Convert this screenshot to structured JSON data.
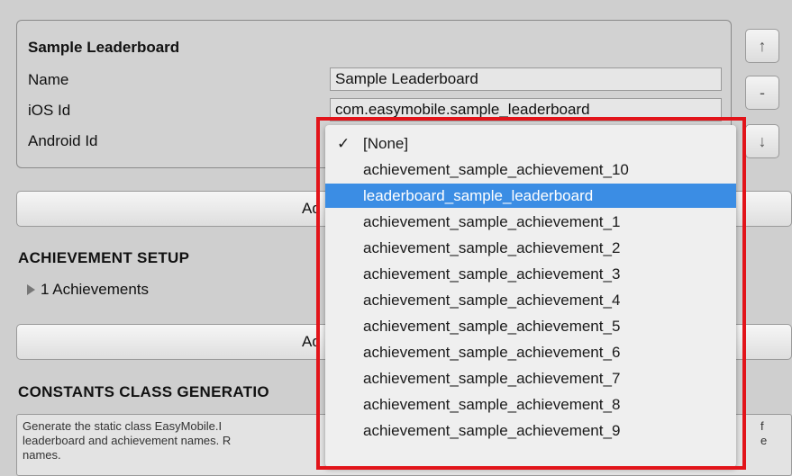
{
  "leaderboard": {
    "title": "Sample Leaderboard",
    "name_label": "Name",
    "name_value": "Sample Leaderboard",
    "ios_label": "iOS Id",
    "ios_value": "com.easymobile.sample_leaderboard",
    "android_label": "Android Id"
  },
  "side_buttons": {
    "up": "↑",
    "remove": "-",
    "down": "↓"
  },
  "add_leaderboard_button": "Ad",
  "achievement_setup": {
    "title": "ACHIEVEMENT SETUP",
    "foldout": "1 Achievements",
    "add_button": "Ad"
  },
  "constants": {
    "title": "CONSTANTS CLASS GENERATIO",
    "help_line1_left": "Generate the static class EasyMobile.I",
    "help_line1_right": "f",
    "help_line2_left": "leaderboard and achievement names. R",
    "help_line2_right": "e",
    "help_line3": "names."
  },
  "dropdown": {
    "check_mark": "✓",
    "selected_index": 2,
    "options": [
      "[None]",
      "achievement_sample_achievement_10",
      "leaderboard_sample_leaderboard",
      "achievement_sample_achievement_1",
      "achievement_sample_achievement_2",
      "achievement_sample_achievement_3",
      "achievement_sample_achievement_4",
      "achievement_sample_achievement_5",
      "achievement_sample_achievement_6",
      "achievement_sample_achievement_7",
      "achievement_sample_achievement_8",
      "achievement_sample_achievement_9"
    ]
  },
  "colors": {
    "selection": "#3b8de4",
    "highlight_outline": "#e2141a"
  }
}
